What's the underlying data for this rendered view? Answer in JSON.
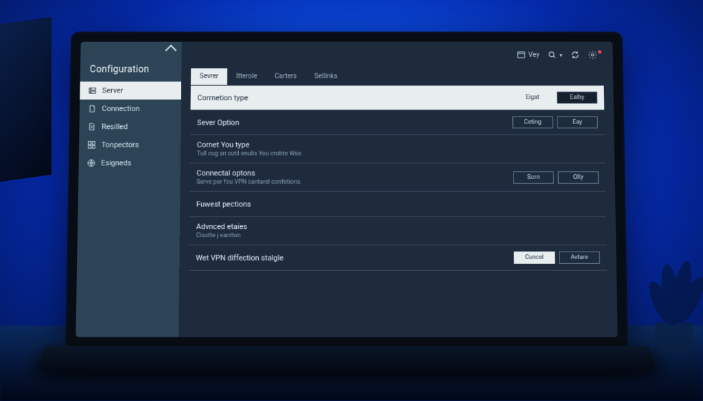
{
  "sidebar": {
    "title": "Configuration",
    "items": [
      {
        "label": "Server",
        "icon": "server-icon"
      },
      {
        "label": "Connection",
        "icon": "doc-icon"
      },
      {
        "label": "Resilled",
        "icon": "doc-icon"
      },
      {
        "label": "Tonpectors",
        "icon": "grid-icon"
      },
      {
        "label": "Esigneds",
        "icon": "globe-icon"
      }
    ]
  },
  "toolbar": {
    "view_label": "Vey",
    "search_placeholder": "Q"
  },
  "tabs": [
    {
      "label": "Sevrer"
    },
    {
      "label": "Itterole"
    },
    {
      "label": "Carters"
    },
    {
      "label": "Sellinks"
    }
  ],
  "rows": {
    "r0": {
      "title": "Corrnetion type",
      "btn1": "Eigat",
      "btn2": "Ealby"
    },
    "r1": {
      "title": "Sever Option",
      "btn1": "Ceting",
      "btn2": "Eay"
    },
    "r2": {
      "title": "Cornet You type",
      "sub": "Tull cug an cutil onulis You crobte Wse."
    },
    "r3": {
      "title": "Connectal optons",
      "sub": "Serve por fou VPN cantarel confetions.",
      "btn1": "Sorn",
      "btn2": "Olly"
    },
    "r4": {
      "title": "Fuwest pections"
    },
    "r5": {
      "title": "Advnced etaies",
      "sub": "Cisotte j eantton"
    },
    "r6": {
      "title": "Wet VPN diffection stalgle",
      "btn1": "Cuncel",
      "btn2": "Avtare"
    }
  }
}
